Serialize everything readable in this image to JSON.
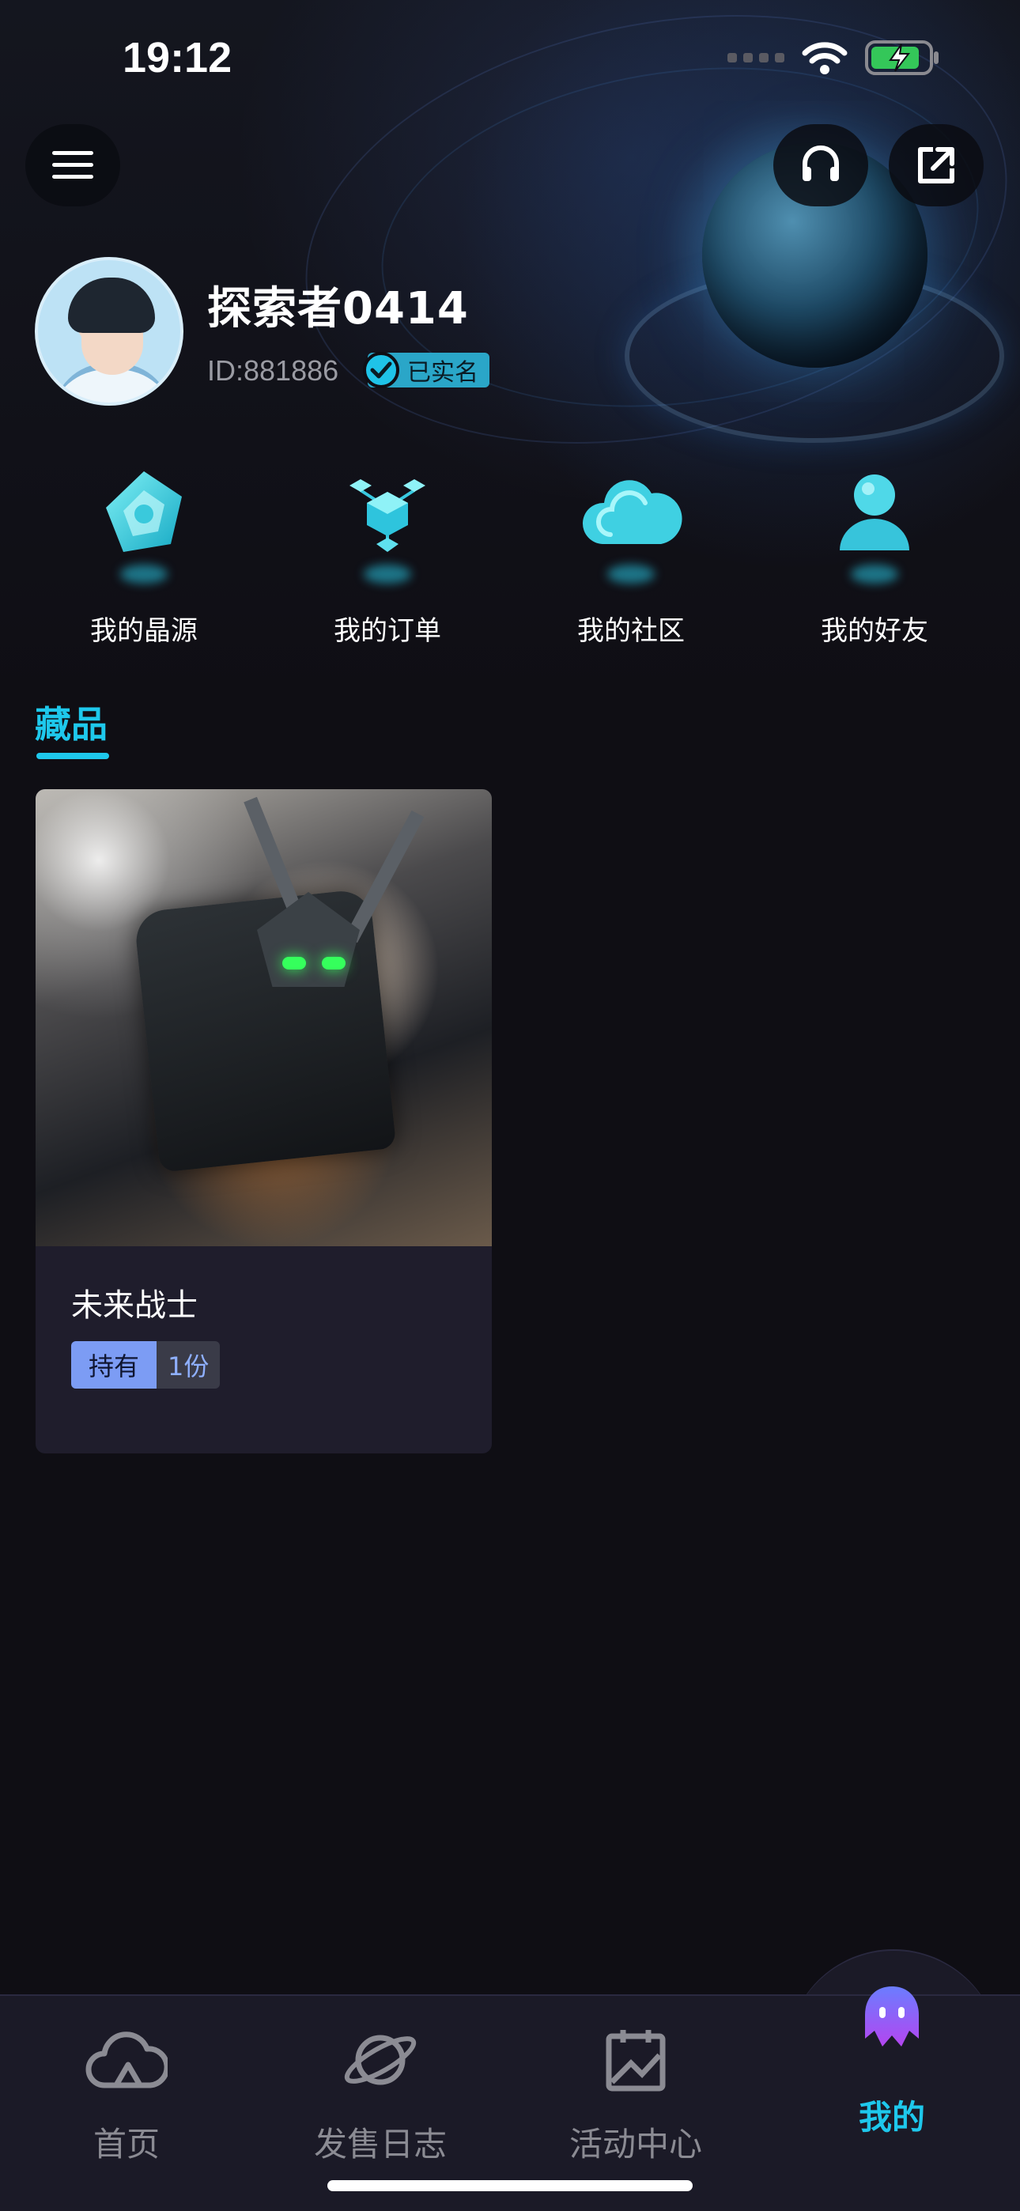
{
  "status_bar": {
    "time": "19:12"
  },
  "header": {
    "menu_icon": "menu-icon",
    "support_icon": "headset-icon",
    "share_icon": "external-link-icon"
  },
  "profile": {
    "username": "探索者0414",
    "id_text": "ID:881886",
    "verified_label": "已实名"
  },
  "quick_actions": [
    {
      "label": "我的晶源",
      "icon": "crystal-gem-icon"
    },
    {
      "label": "我的订单",
      "icon": "cubes-network-icon"
    },
    {
      "label": "我的社区",
      "icon": "cloud-icon"
    },
    {
      "label": "我的好友",
      "icon": "person-icon"
    }
  ],
  "collection": {
    "tab_label": "藏品",
    "items": [
      {
        "title": "未来战士",
        "holding_label": "持有",
        "holding_value": "1份"
      }
    ]
  },
  "bottom_nav": {
    "items": [
      {
        "label": "首页",
        "icon": "cloud-home-icon",
        "active": false
      },
      {
        "label": "发售日志",
        "icon": "planet-icon",
        "active": false
      },
      {
        "label": "活动中心",
        "icon": "calendar-icon",
        "active": false
      },
      {
        "label": "我的",
        "icon": "ghost-avatar-icon",
        "active": true
      }
    ]
  },
  "colors": {
    "background": "#0f0e14",
    "accent": "#1ec8ec",
    "card": "#1f1d2c",
    "nav": "#1b1a27",
    "holding_badge": "#7c9cf4"
  }
}
